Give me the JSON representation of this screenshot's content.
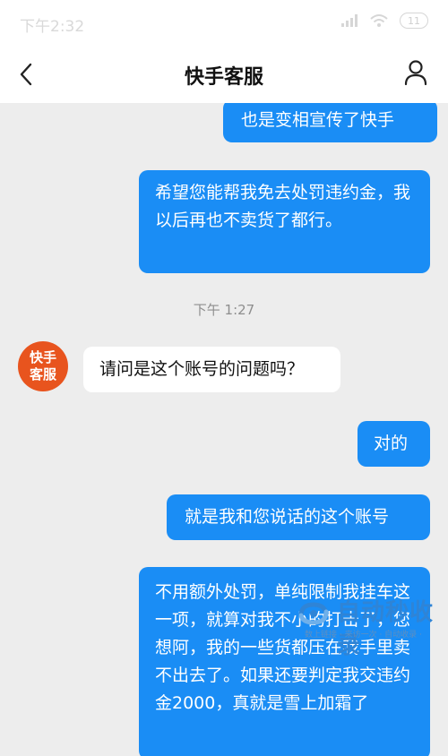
{
  "status_bar": {
    "time": "下午2:32",
    "battery": "11"
  },
  "header": {
    "title": "快手客服"
  },
  "messages": [
    {
      "text": "也是变相宣传了快手"
    },
    {
      "text": "希望您能帮我免去处罚违约金，我以后再也不卖货了都行。"
    },
    {
      "text": "请问是这个账号的问题吗？"
    },
    {
      "text": "对的"
    },
    {
      "text": "就是我和您说话的这个账号"
    },
    {
      "text": "不用额外处罚，单纯限制我挂车这一项，就算对我不小的打击了，您想阿，我的一些货都压在我手里卖不出去了。如果还要判定我交违约金2000，真就是雪上加霜了"
    }
  ],
  "timestamp": "下午 1:27",
  "agent_avatar": {
    "line1": "快手",
    "line2": "客服"
  },
  "watermark": {
    "title": "自动秒收录",
    "subtitle": "数上链接 · 来访一次 · 自动收录 ·"
  },
  "colors": {
    "outgoing_bubble": "#1a8df5",
    "avatar": "#e8541e",
    "background": "#ededed"
  }
}
